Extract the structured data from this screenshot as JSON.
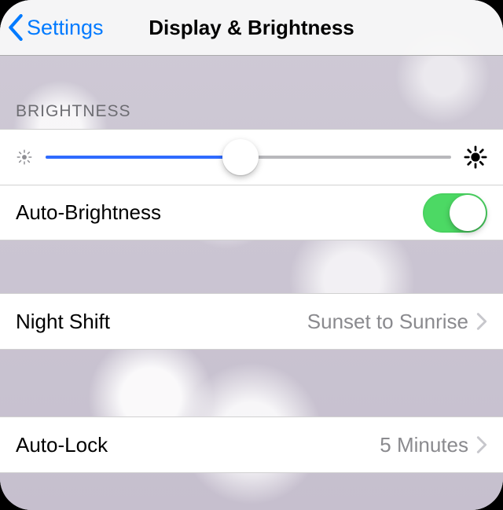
{
  "nav": {
    "back_label": "Settings",
    "title": "Display & Brightness"
  },
  "section": {
    "brightness_header": "Brightness"
  },
  "brightness": {
    "slider_percent": 48,
    "auto_label": "Auto-Brightness",
    "auto_enabled": true
  },
  "night_shift": {
    "label": "Night Shift",
    "detail": "Sunset to Sunrise"
  },
  "auto_lock": {
    "label": "Auto-Lock",
    "detail": "5 Minutes"
  },
  "colors": {
    "tint": "#007aff",
    "toggle_on": "#4cd964"
  }
}
